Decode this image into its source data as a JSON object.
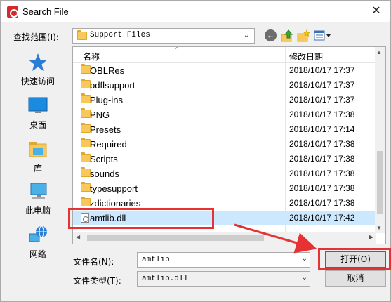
{
  "window": {
    "title": "Search File"
  },
  "toolbar": {
    "look_in_label": "查找范围(I):",
    "look_in_value": "Support Files"
  },
  "places": [
    {
      "label": "快速访问",
      "icon": "star-icon"
    },
    {
      "label": "桌面",
      "icon": "desktop-icon"
    },
    {
      "label": "库",
      "icon": "library-icon"
    },
    {
      "label": "此电脑",
      "icon": "computer-icon"
    },
    {
      "label": "网络",
      "icon": "network-icon"
    }
  ],
  "columns": {
    "name": "名称",
    "date": "修改日期"
  },
  "files": [
    {
      "name": "OBLRes",
      "date": "2018/10/17 17:37",
      "type": "folder"
    },
    {
      "name": "pdflsupport",
      "date": "2018/10/17 17:37",
      "type": "folder"
    },
    {
      "name": "Plug-ins",
      "date": "2018/10/17 17:37",
      "type": "folder"
    },
    {
      "name": "PNG",
      "date": "2018/10/17 17:38",
      "type": "folder"
    },
    {
      "name": "Presets",
      "date": "2018/10/17 17:14",
      "type": "folder"
    },
    {
      "name": "Required",
      "date": "2018/10/17 17:38",
      "type": "folder"
    },
    {
      "name": "Scripts",
      "date": "2018/10/17 17:38",
      "type": "folder"
    },
    {
      "name": "sounds",
      "date": "2018/10/17 17:38",
      "type": "folder"
    },
    {
      "name": "typesupport",
      "date": "2018/10/17 17:38",
      "type": "folder"
    },
    {
      "name": "zdictionaries",
      "date": "2018/10/17 17:38",
      "type": "folder"
    },
    {
      "name": "amtlib.dll",
      "date": "2018/10/17 17:42",
      "type": "dll",
      "selected": true
    }
  ],
  "filename": {
    "label": "文件名(N):",
    "value": "amtlib"
  },
  "filetype": {
    "label": "文件类型(T):",
    "value": "amtlib.dll"
  },
  "buttons": {
    "open": "打开(O)",
    "cancel": "取消"
  },
  "colors": {
    "annotation": "#e63232",
    "selection": "#cce8ff",
    "accent": "#0078d7"
  }
}
